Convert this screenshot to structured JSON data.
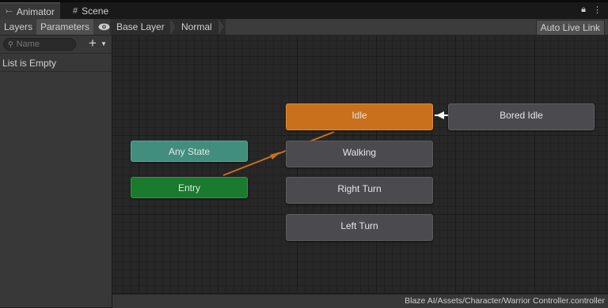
{
  "window_tabs": [
    {
      "label": "Animator",
      "icon": "animator-icon",
      "active": true
    },
    {
      "label": "Scene",
      "icon": "grid-icon",
      "active": false
    }
  ],
  "window_controls": {
    "lock": "lock-icon",
    "menu": "kebab-menu-icon"
  },
  "toolbar": {
    "layers_label": "Layers",
    "parameters_label": "Parameters",
    "eye_icon": "eye-icon",
    "breadcrumbs": [
      "Base Layer",
      "Normal"
    ],
    "auto_live_link_label": "Auto Live Link"
  },
  "left_panel": {
    "search_placeholder": "Name",
    "add_icon": "plus-icon",
    "empty_text": "List is Empty"
  },
  "graph": {
    "states": [
      {
        "name": "Idle",
        "kind": "default",
        "color": "#c8701c"
      },
      {
        "name": "Bored Idle",
        "kind": "normal",
        "color": "#4b4b4f"
      },
      {
        "name": "Walking",
        "kind": "normal",
        "color": "#4b4b4f"
      },
      {
        "name": "Right Turn",
        "kind": "normal",
        "color": "#4b4b4f"
      },
      {
        "name": "Left Turn",
        "kind": "normal",
        "color": "#4b4b4f"
      },
      {
        "name": "Any State",
        "kind": "any",
        "color": "#418e7c"
      },
      {
        "name": "Entry",
        "kind": "entry",
        "color": "#1a7a2e"
      }
    ],
    "transitions": [
      {
        "from": "Entry",
        "to": "Idle",
        "color": "#c8701c"
      },
      {
        "from": "Bored Idle",
        "to": "Idle",
        "color": "#ffffff"
      }
    ]
  },
  "status_bar": {
    "path": "Blaze AI/Assets/Character/Warrior Controller.controller"
  }
}
